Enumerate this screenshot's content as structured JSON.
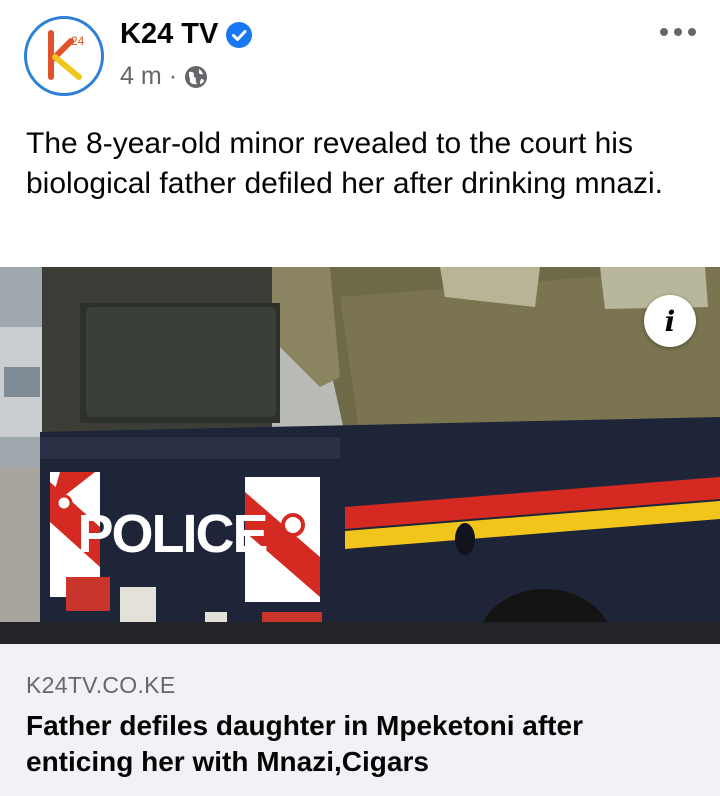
{
  "post": {
    "page_name": "K24 TV",
    "verified": true,
    "time_ago": "4 m",
    "separator": "·",
    "audience_icon": "globe-icon",
    "avatar_text": "24",
    "text": "The 8-year-old minor revealed to the court his biological father defiled her after drinking mnazi."
  },
  "link_preview": {
    "image_label": "POLICE",
    "domain": "K24TV.CO.KE",
    "title": "Father defiles daughter in Mpeketoni after enticing her with Mnazi,Cigars",
    "info_icon": "i"
  },
  "colors": {
    "avatar_ring": "#2d7fd8",
    "verified_blue": "#1877f2",
    "secondary_text": "#65676b",
    "footer_bg": "#f0f2f5",
    "truck_body": "#1e2538",
    "canvas": "#6f6a4a",
    "stripe_red": "#d42a22",
    "stripe_yellow": "#f2c51a"
  }
}
